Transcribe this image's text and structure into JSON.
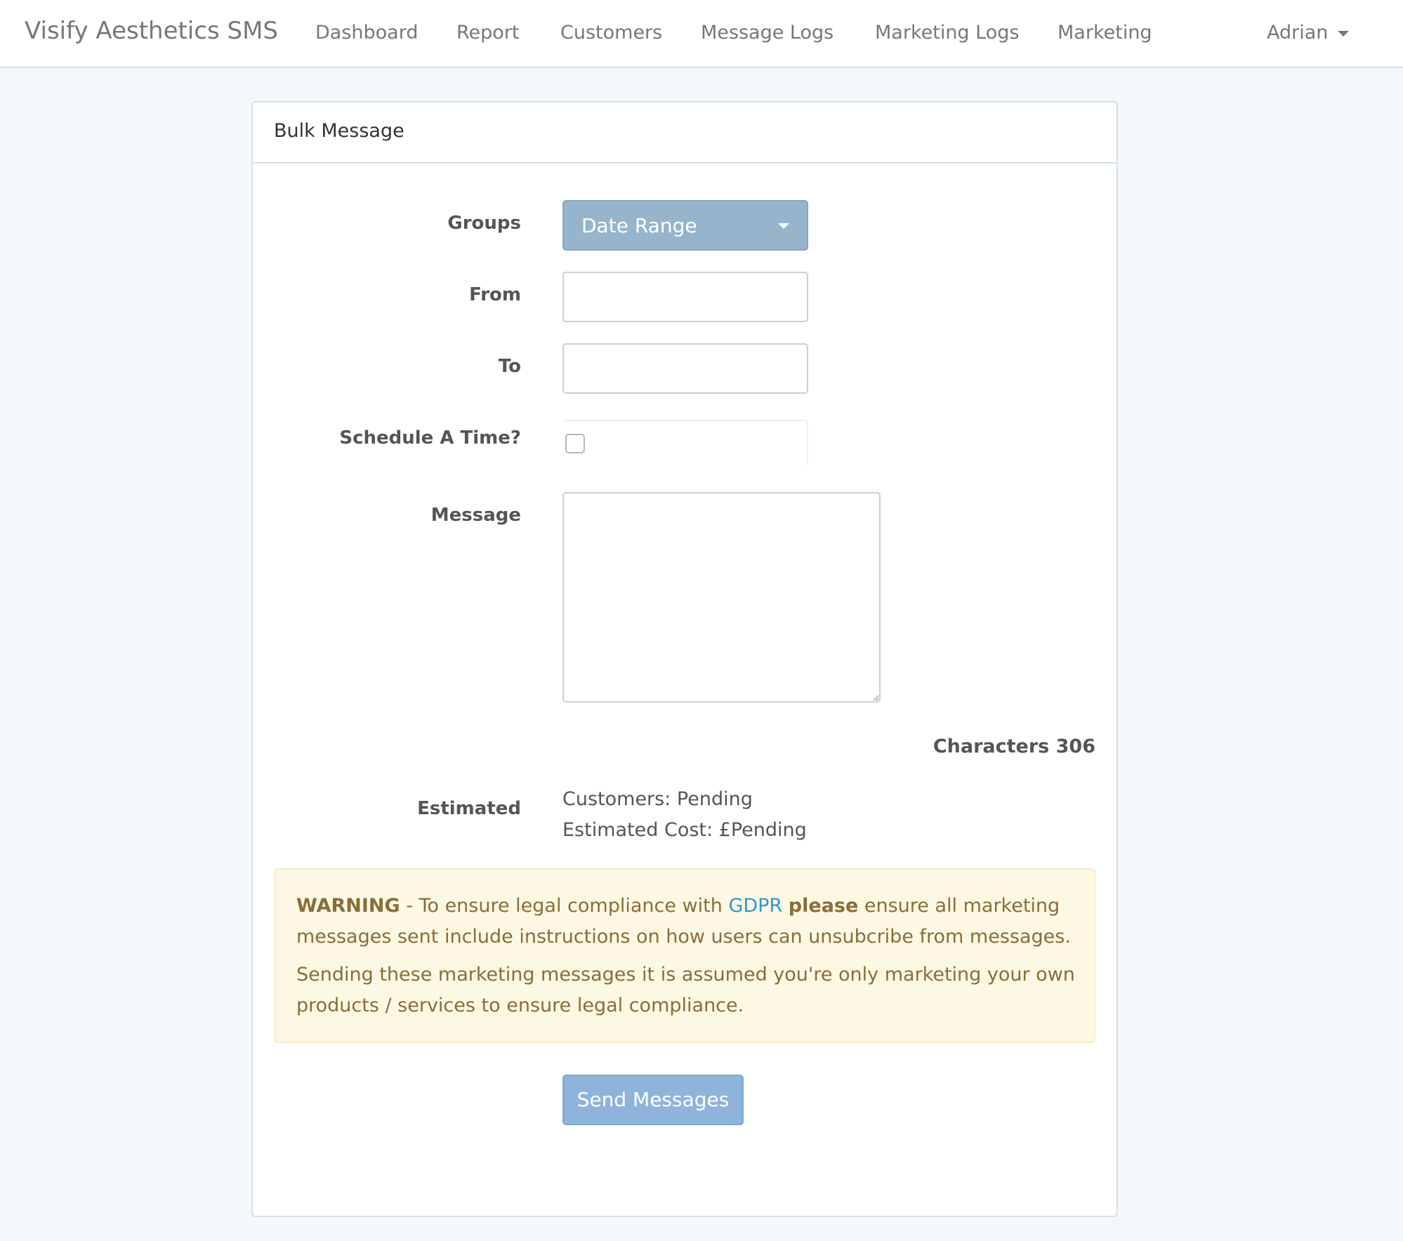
{
  "navbar": {
    "brand": "Visify Aesthetics SMS",
    "items": [
      {
        "label": "Dashboard"
      },
      {
        "label": "Report"
      },
      {
        "label": "Customers"
      },
      {
        "label": "Message Logs"
      },
      {
        "label": "Marketing Logs"
      },
      {
        "label": "Marketing"
      }
    ],
    "user": "Adrian"
  },
  "panel": {
    "title": "Bulk Message"
  },
  "form": {
    "groups_label": "Groups",
    "groups_value": "Date Range",
    "from_label": "From",
    "from_value": "",
    "to_label": "To",
    "to_value": "",
    "schedule_label": "Schedule A Time?",
    "schedule_checked": false,
    "message_label": "Message",
    "message_value": "",
    "characters_text": "Characters 306",
    "estimated_label": "Estimated",
    "customers_text": "Customers: Pending",
    "cost_text": "Estimated Cost: £Pending",
    "send_label": "Send Messages"
  },
  "warning": {
    "strong1": "WARNING",
    "text1": " - To ensure legal compliance with ",
    "link": "GDPR",
    "space": " ",
    "strong2": "please",
    "text2": " ensure all marketing messages sent include instructions on how users can unsubcribe from messages.",
    "paragraph2": "Sending these marketing messages it is assumed you're only marketing your own products / services to ensure legal compliance."
  },
  "colors": {
    "accent": "#3097d1",
    "dropdown_bg": "#97b4cd",
    "send_bg": "#8eb4dc",
    "warning_bg": "#fcf8e3",
    "warning_text": "#8a6d3b"
  }
}
